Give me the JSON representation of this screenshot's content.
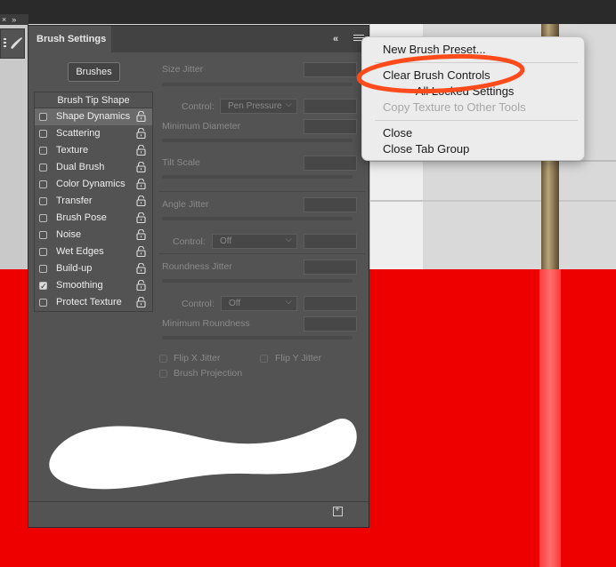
{
  "toolbar": {
    "expand_glyph": "»",
    "close_glyph": "×"
  },
  "panel": {
    "tab_title": "Brush Settings",
    "collapse_glyph": "«",
    "brushes_button": "Brushes",
    "tip_shape": "Brush Tip Shape",
    "items": [
      {
        "label": "Shape Dynamics",
        "checked": false,
        "selected": true
      },
      {
        "label": "Scattering",
        "checked": false
      },
      {
        "label": "Texture",
        "checked": false
      },
      {
        "label": "Dual Brush",
        "checked": false
      },
      {
        "label": "Color Dynamics",
        "checked": false
      },
      {
        "label": "Transfer",
        "checked": false
      },
      {
        "label": "Brush Pose",
        "checked": false
      },
      {
        "label": "Noise",
        "checked": false
      },
      {
        "label": "Wet Edges",
        "checked": false
      },
      {
        "label": "Build-up",
        "checked": false
      },
      {
        "label": "Smoothing",
        "checked": true
      },
      {
        "label": "Protect Texture",
        "checked": false
      }
    ],
    "settings": {
      "size_jitter": "Size Jitter",
      "control_label": "Control:",
      "control_size": "Pen Pressure",
      "minimum_diameter": "Minimum Diameter",
      "tilt_scale": "Tilt Scale",
      "angle_jitter": "Angle Jitter",
      "control_angle": "Off",
      "roundness_jitter": "Roundness Jitter",
      "control_roundness": "Off",
      "minimum_roundness": "Minimum Roundness",
      "flip_x": "Flip X Jitter",
      "flip_y": "Flip Y Jitter",
      "brush_projection": "Brush Projection"
    }
  },
  "menu": {
    "items": [
      {
        "label": "New Brush Preset...",
        "enabled": true
      },
      {
        "label": "Clear Brush Controls",
        "enabled": true
      },
      {
        "label": "Reset All Locked Settings",
        "enabled": true
      },
      {
        "label": "Copy Texture to Other Tools",
        "enabled": false
      },
      {
        "label": "Close",
        "enabled": true
      },
      {
        "label": "Close Tab Group",
        "enabled": true
      }
    ]
  },
  "colors": {
    "highlight": "#ff4a1c",
    "panel_bg": "#535353",
    "menu_bg": "#ececec",
    "floor_red": "#ef0000"
  }
}
